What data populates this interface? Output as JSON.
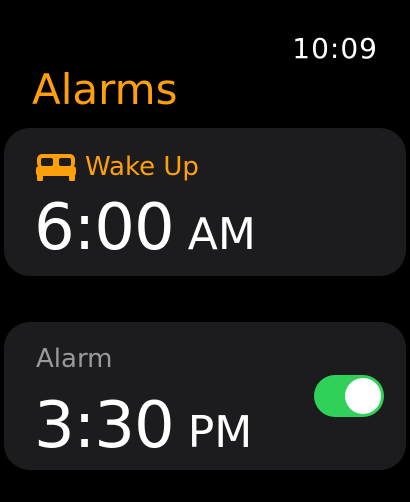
{
  "status": {
    "time": "10:09"
  },
  "header": {
    "title": "Alarms"
  },
  "alarms": [
    {
      "label": "Wake Up",
      "icon": "bed-icon",
      "time": "6:00",
      "ampm": "AM"
    },
    {
      "label": "Alarm",
      "time": "3:30",
      "ampm": "PM",
      "enabled": true
    }
  ],
  "colors": {
    "accent": "#ff9f0a",
    "card_background": "#1c1c1e",
    "toggle_on": "#30d158",
    "secondary_text": "#98989d"
  }
}
